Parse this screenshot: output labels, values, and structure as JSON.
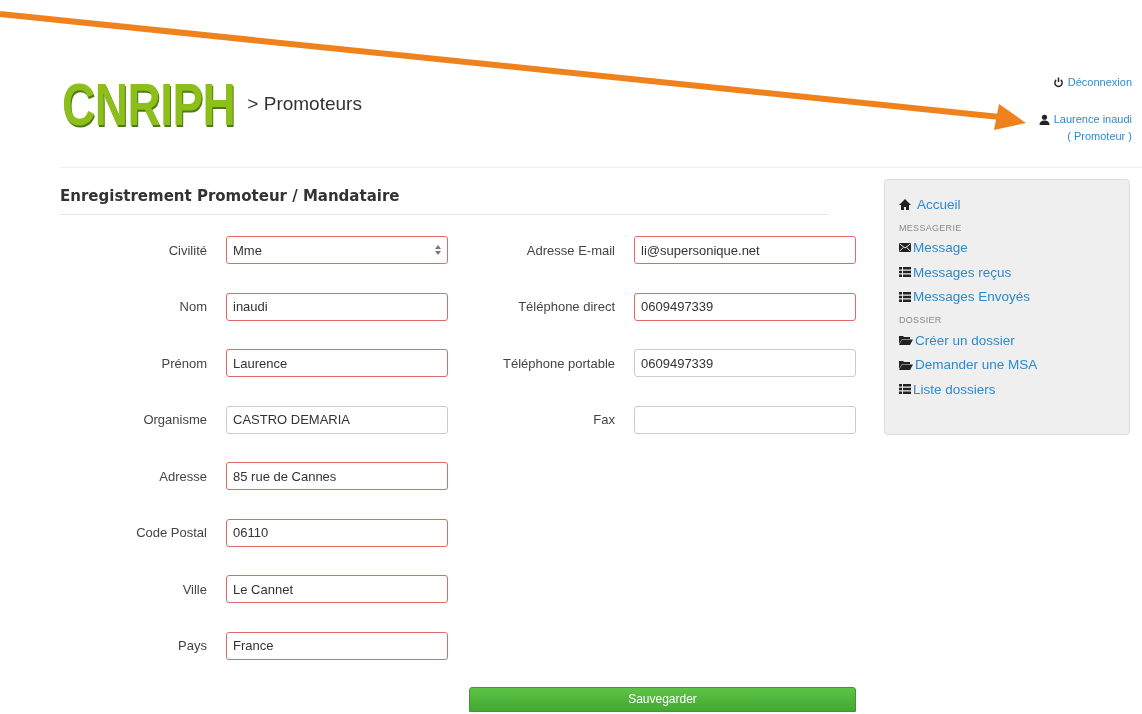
{
  "header": {
    "logo": "CNRIPH",
    "breadcrumb": "> Promoteurs",
    "logout": "Déconnexion",
    "user": "Laurence inaudi",
    "role": "( Promoteur )"
  },
  "form": {
    "title": "Enregistrement Promoteur / Mandataire",
    "left_fields": [
      {
        "label": "Civilité",
        "value": "Mme",
        "kind": "select",
        "invalid": true
      },
      {
        "label": "Nom",
        "value": "inaudi",
        "kind": "text",
        "invalid": true
      },
      {
        "label": "Prénom",
        "value": "Laurence",
        "kind": "text",
        "invalid": true
      },
      {
        "label": "Organisme",
        "value": "CASTRO DEMARIA",
        "kind": "text",
        "invalid": false
      },
      {
        "label": "Adresse",
        "value": "85 rue de Cannes",
        "kind": "text",
        "invalid": true
      },
      {
        "label": "Code Postal",
        "value": "06110",
        "kind": "text",
        "invalid": true
      },
      {
        "label": "Ville",
        "value": "Le Cannet",
        "kind": "text",
        "invalid": true
      },
      {
        "label": "Pays",
        "value": "France",
        "kind": "text",
        "invalid": true
      }
    ],
    "right_fields": [
      {
        "label": "Adresse E-mail",
        "value": "li@supersonique.net",
        "kind": "text",
        "invalid": true
      },
      {
        "label": "Téléphone direct",
        "value": "0609497339",
        "kind": "text",
        "invalid": true
      },
      {
        "label": "Téléphone portable",
        "value": "0609497339",
        "kind": "text",
        "invalid": false
      },
      {
        "label": "Fax",
        "kind": "text",
        "invalid": false
      }
    ],
    "submit": "Sauvegarder"
  },
  "sidebar": {
    "home": "Accueil",
    "sections": [
      {
        "heading": "MESSAGERIE",
        "items": [
          {
            "label": "Message",
            "kind": "mail"
          },
          {
            "label": "Messages reçus",
            "kind": "list"
          },
          {
            "label": "Messages Envoyés",
            "kind": "list"
          }
        ]
      },
      {
        "heading": "DOSSIER",
        "items": [
          {
            "label": "Créer un dossier",
            "kind": "folder"
          },
          {
            "label": "Demander une MSA",
            "kind": "folder"
          },
          {
            "label": "Liste dossiers",
            "kind": "list"
          }
        ]
      }
    ]
  }
}
